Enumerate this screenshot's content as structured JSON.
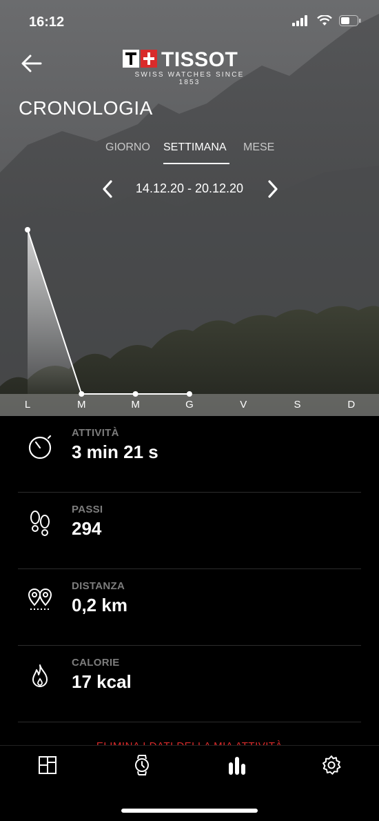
{
  "status_bar": {
    "time": "16:12"
  },
  "header": {
    "logo_text": "TISSOT",
    "logo_subtitle": "SWISS WATCHES SINCE 1853",
    "title": "CRONOLOGIA"
  },
  "tabs": [
    {
      "label": "GIORNO",
      "active": false
    },
    {
      "label": "SETTIMANA",
      "active": true
    },
    {
      "label": "MESE",
      "active": false
    }
  ],
  "date_range": "14.12.20 - 20.12.20",
  "chart_data": {
    "type": "area",
    "categories": [
      "L",
      "M",
      "M",
      "G",
      "V",
      "S",
      "D"
    ],
    "values": [
      294,
      0,
      0,
      0,
      null,
      null,
      null
    ],
    "ylim": [
      0,
      294
    ],
    "grid": false,
    "line_color": "#ffffff"
  },
  "stats": [
    {
      "label": "ATTIVITÀ",
      "value": "3 min 21 s",
      "icon": "stopwatch-icon"
    },
    {
      "label": "PASSI",
      "value": "294",
      "icon": "footprints-icon"
    },
    {
      "label": "DISTANZA",
      "value": "0,2 km",
      "icon": "map-pins-icon"
    },
    {
      "label": "CALORIE",
      "value": "17 kcal",
      "icon": "flame-icon"
    }
  ],
  "delete_link": "ELIMINA I DATI DELLA MIA ATTIVITÀ",
  "colors": {
    "accent_red": "#d92b2b",
    "background": "#000000",
    "label_gray": "#7d7d7d"
  },
  "bottom_nav": [
    {
      "icon": "dashboard-icon"
    },
    {
      "icon": "watch-icon"
    },
    {
      "icon": "bar-chart-icon"
    },
    {
      "icon": "gear-icon"
    }
  ]
}
